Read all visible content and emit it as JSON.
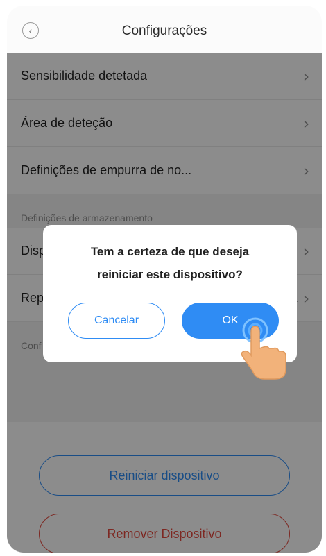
{
  "header": {
    "title": "Configurações",
    "back_icon": "chevron-left-icon"
  },
  "settings": {
    "rows_top": [
      {
        "label": "Sensibilidade detetada"
      },
      {
        "label": "Área de deteção"
      },
      {
        "label": "Definições de empurra de no..."
      }
    ],
    "storage_section": "Definições de armazenamento",
    "rows_storage": [
      {
        "label": "Disp"
      },
      {
        "label": "Rep",
        "value": "..."
      }
    ],
    "config_section": "Conf"
  },
  "actions": {
    "reboot_label": "Reiniciar dispositivo",
    "remove_label": "Remover Dispositivo"
  },
  "dialog": {
    "message_line1": "Tem a certeza de que deseja",
    "message_line2": "reiniciar este dispositivo?",
    "cancel_label": "Cancelar",
    "ok_label": "OK"
  },
  "colors": {
    "accent": "#2f8cf4",
    "danger": "#e44a3f",
    "hand": "#f2b27a"
  }
}
